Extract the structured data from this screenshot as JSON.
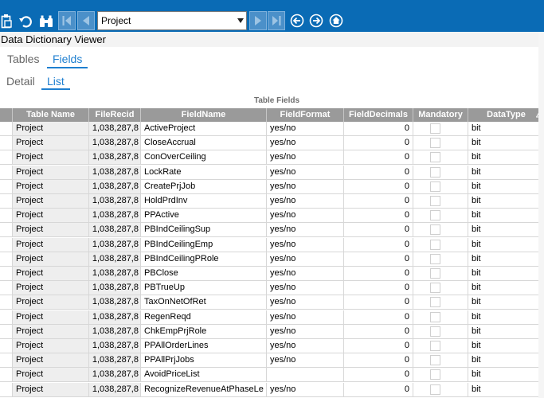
{
  "colors": {
    "toolbar": "#0a6bb5",
    "accent": "#1e7fd0",
    "header_bg": "#9a9a9a"
  },
  "toolbar": {
    "icons": [
      "clipboard-icon",
      "undo-icon",
      "binoculars-icon",
      "first-record-icon",
      "previous-record-icon",
      "next-record-icon",
      "last-record-icon",
      "back-icon",
      "forward-icon",
      "home-icon"
    ],
    "table_selector": {
      "selected": "Project"
    }
  },
  "window": {
    "title": "Data Dictionary Viewer"
  },
  "tabs_top": [
    {
      "label": "Tables",
      "active": false
    },
    {
      "label": "Fields",
      "active": true
    }
  ],
  "tabs_view": [
    {
      "label": "Detail",
      "active": false
    },
    {
      "label": "List",
      "active": true
    }
  ],
  "grid": {
    "caption": "Table Fields",
    "columns": [
      "Table Name",
      "FileRecid",
      "FieldName",
      "FieldFormat",
      "FieldDecimals",
      "Mandatory",
      "DataType"
    ],
    "rows": [
      {
        "table": "Project",
        "recid": "1,038,287,8",
        "field": "ActiveProject",
        "format": "yes/no",
        "decimals": "0",
        "mandatory": false,
        "type": "bit"
      },
      {
        "table": "Project",
        "recid": "1,038,287,8",
        "field": "CloseAccrual",
        "format": "yes/no",
        "decimals": "0",
        "mandatory": false,
        "type": "bit"
      },
      {
        "table": "Project",
        "recid": "1,038,287,8",
        "field": "ConOverCeiling",
        "format": "yes/no",
        "decimals": "0",
        "mandatory": false,
        "type": "bit"
      },
      {
        "table": "Project",
        "recid": "1,038,287,8",
        "field": "LockRate",
        "format": "yes/no",
        "decimals": "0",
        "mandatory": false,
        "type": "bit"
      },
      {
        "table": "Project",
        "recid": "1,038,287,8",
        "field": "CreatePrjJob",
        "format": "yes/no",
        "decimals": "0",
        "mandatory": false,
        "type": "bit"
      },
      {
        "table": "Project",
        "recid": "1,038,287,8",
        "field": "HoldPrdInv",
        "format": "yes/no",
        "decimals": "0",
        "mandatory": false,
        "type": "bit"
      },
      {
        "table": "Project",
        "recid": "1,038,287,8",
        "field": "PPActive",
        "format": "yes/no",
        "decimals": "0",
        "mandatory": false,
        "type": "bit"
      },
      {
        "table": "Project",
        "recid": "1,038,287,8",
        "field": "PBIndCeilingSup",
        "format": "yes/no",
        "decimals": "0",
        "mandatory": false,
        "type": "bit"
      },
      {
        "table": "Project",
        "recid": "1,038,287,8",
        "field": "PBIndCeilingEmp",
        "format": "yes/no",
        "decimals": "0",
        "mandatory": false,
        "type": "bit"
      },
      {
        "table": "Project",
        "recid": "1,038,287,8",
        "field": "PBIndCeilingPRole",
        "format": "yes/no",
        "decimals": "0",
        "mandatory": false,
        "type": "bit"
      },
      {
        "table": "Project",
        "recid": "1,038,287,8",
        "field": "PBClose",
        "format": "yes/no",
        "decimals": "0",
        "mandatory": false,
        "type": "bit"
      },
      {
        "table": "Project",
        "recid": "1,038,287,8",
        "field": "PBTrueUp",
        "format": "yes/no",
        "decimals": "0",
        "mandatory": false,
        "type": "bit"
      },
      {
        "table": "Project",
        "recid": "1,038,287,8",
        "field": "TaxOnNetOfRet",
        "format": "yes/no",
        "decimals": "0",
        "mandatory": false,
        "type": "bit"
      },
      {
        "table": "Project",
        "recid": "1,038,287,8",
        "field": "RegenReqd",
        "format": "yes/no",
        "decimals": "0",
        "mandatory": false,
        "type": "bit"
      },
      {
        "table": "Project",
        "recid": "1,038,287,8",
        "field": "ChkEmpPrjRole",
        "format": "yes/no",
        "decimals": "0",
        "mandatory": false,
        "type": "bit"
      },
      {
        "table": "Project",
        "recid": "1,038,287,8",
        "field": "PPAllOrderLines",
        "format": "yes/no",
        "decimals": "0",
        "mandatory": false,
        "type": "bit"
      },
      {
        "table": "Project",
        "recid": "1,038,287,8",
        "field": "PPAllPrjJobs",
        "format": "yes/no",
        "decimals": "0",
        "mandatory": false,
        "type": "bit"
      },
      {
        "table": "Project",
        "recid": "1,038,287,8",
        "field": "AvoidPriceList",
        "format": "",
        "decimals": "0",
        "mandatory": false,
        "type": "bit"
      },
      {
        "table": "Project",
        "recid": "1,038,287,8",
        "field": "RecognizeRevenueAtPhaseLe",
        "format": "yes/no",
        "decimals": "0",
        "mandatory": false,
        "type": "bit"
      }
    ]
  }
}
